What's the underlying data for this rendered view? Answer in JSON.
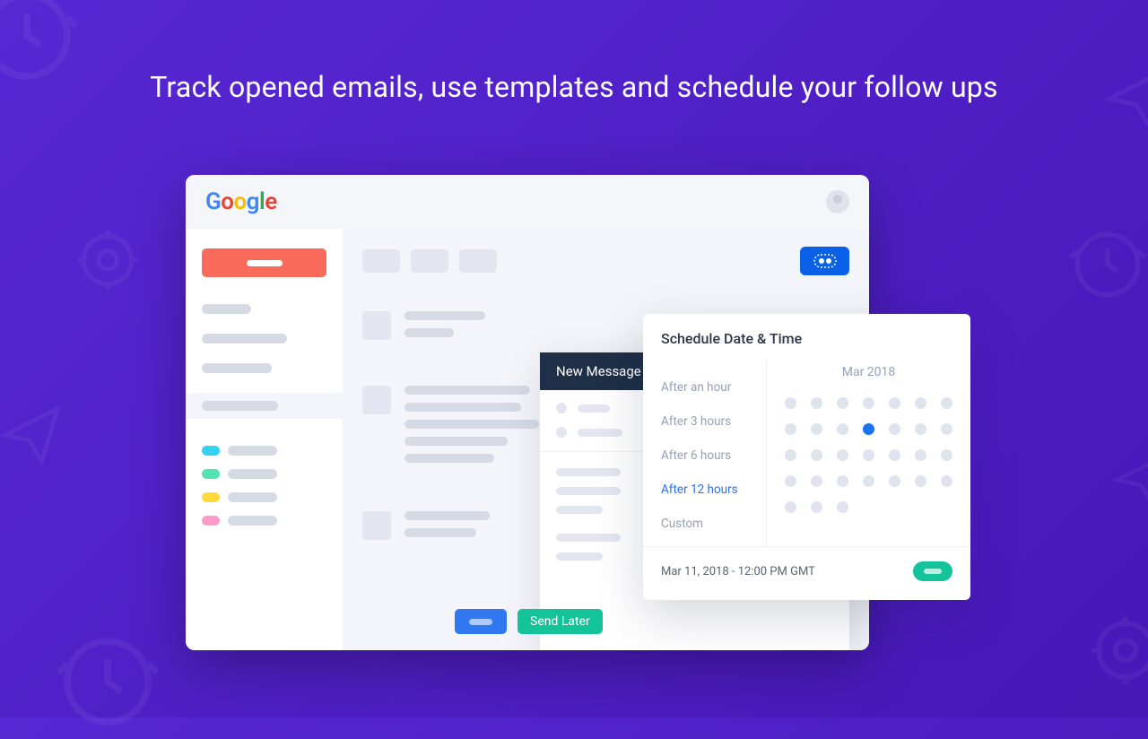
{
  "headline": "Track opened emails, use templates and schedule your follow ups",
  "header": {
    "logo": "Google"
  },
  "compose": {
    "title": "New Message",
    "send_later": "Send Later"
  },
  "schedule": {
    "title": "Schedule Date & Time",
    "presets": [
      "After an hour",
      "After 3 hours",
      "After 6 hours",
      "After 12 hours",
      "Custom"
    ],
    "active_preset_index": 3,
    "calendar_title": "Mar 2018",
    "selected_date": "Mar 11, 2018 - 12:00 PM GMT",
    "days_count": 31,
    "selected_day_index": 10
  },
  "sidebar": {
    "tag_colors": [
      "#31d2f2",
      "#54e3b0",
      "#ffda3a",
      "#ff9bc9"
    ]
  }
}
